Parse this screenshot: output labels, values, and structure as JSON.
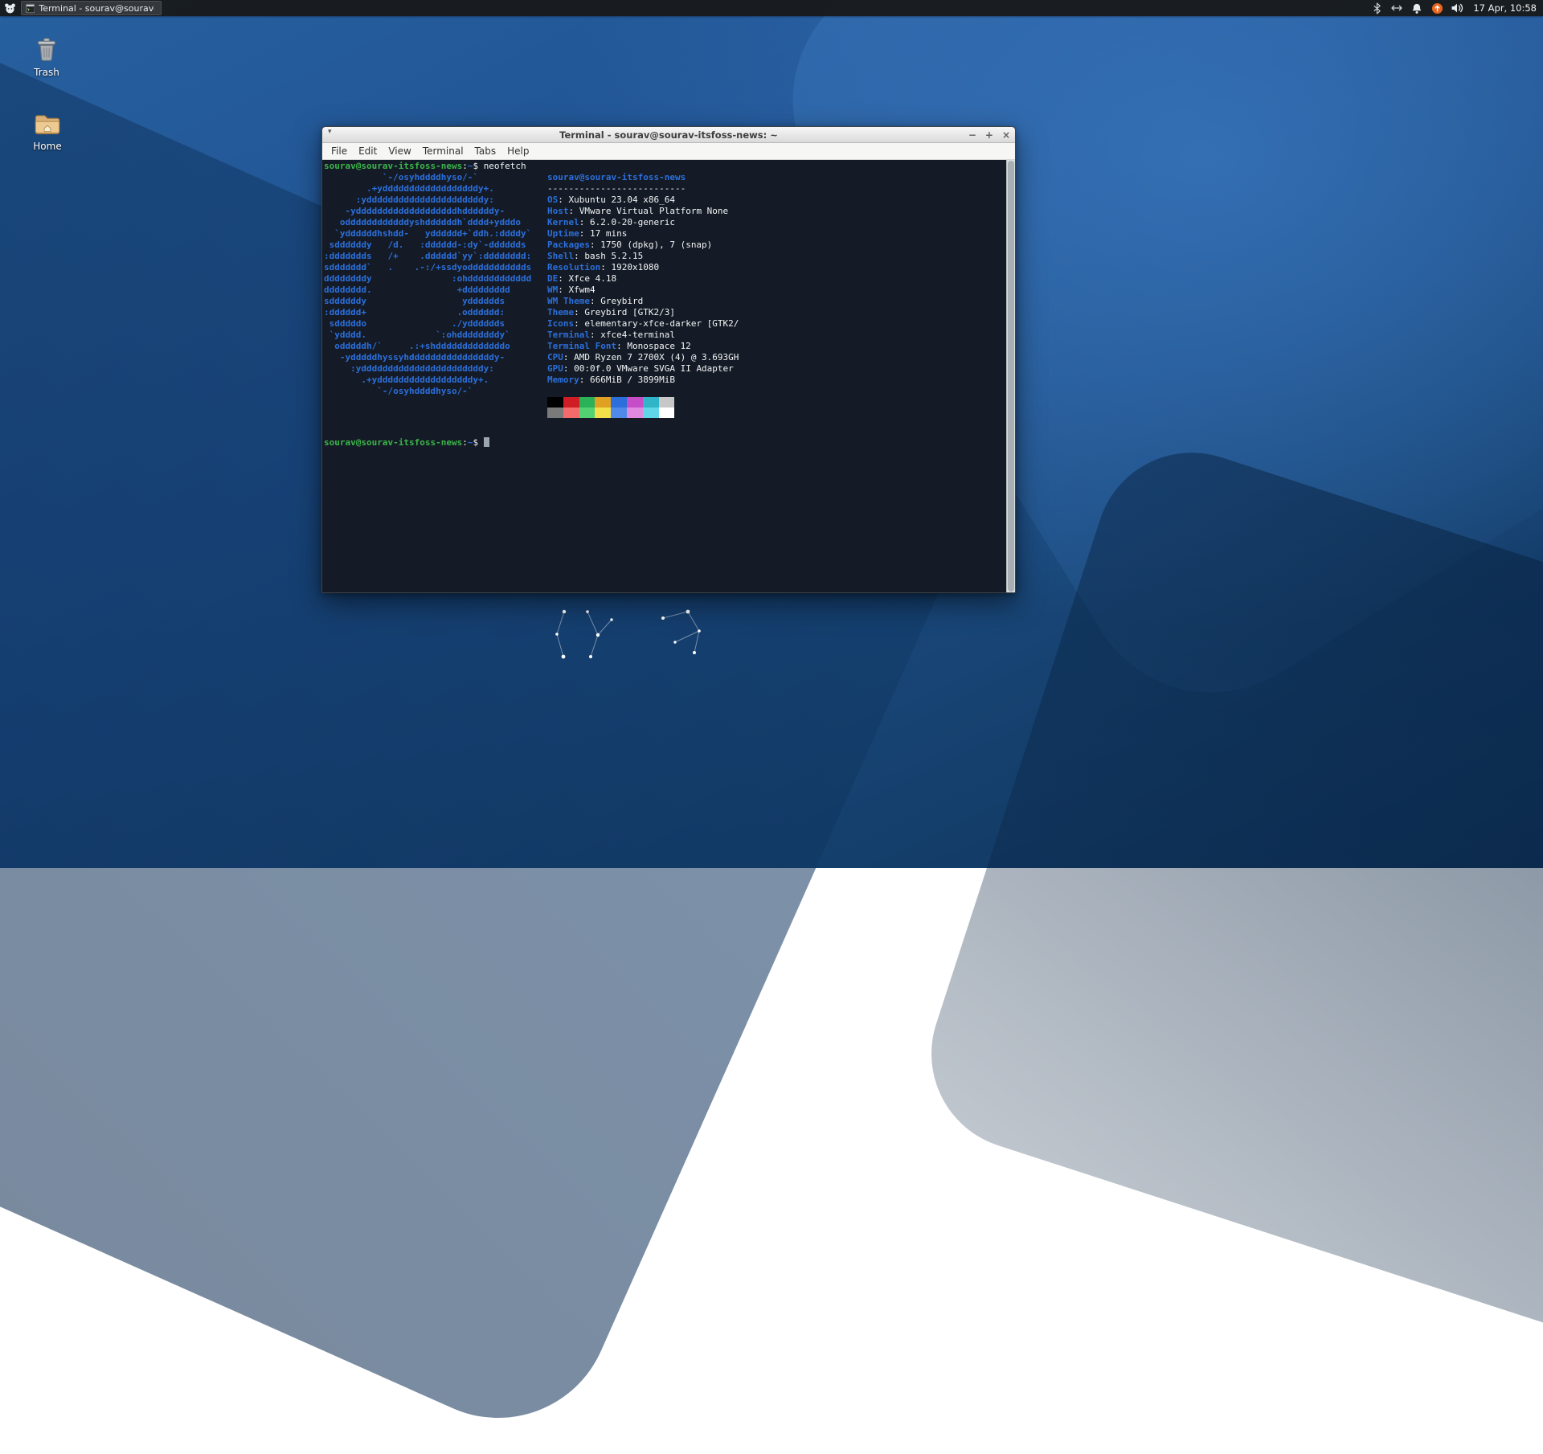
{
  "panel": {
    "window_button": "Terminal - sourav@sourav-it...",
    "clock": "17 Apr, 10:58"
  },
  "desktop": {
    "trash_label": "Trash",
    "home_label": "Home"
  },
  "window": {
    "title": "Terminal - sourav@sourav-itsfoss-news: ~",
    "menu": [
      "File",
      "Edit",
      "View",
      "Terminal",
      "Tabs",
      "Help"
    ],
    "controls": {
      "menu": "▾",
      "minimize": "−",
      "maximize": "+",
      "close": "×"
    }
  },
  "terminal": {
    "prompt_user": "sourav@sourav-itsfoss-news",
    "prompt_colon": ":",
    "prompt_path": "~",
    "prompt_dollar": "$",
    "command": "neofetch",
    "ascii_art": [
      "           `-/osyhddddhyso/-`",
      "        .+yddddddddddddddddddy+.",
      "      :yddddddddddddddddddddddy:",
      "    -ydddddddddddddddddddhddddddy-",
      "   oddddddddddddyshddddddh`dddd+ydddo",
      "  `yddddddhshdd-   ydddddd+`ddh.:ddddy`",
      " sddddddy   /d.   :dddddd-:dy`-dddddds",
      ":ddddddds   /+    .dddddd`yy`:dddddddd:",
      "sddddddd`   .    .-:/+ssdyoddddddddddds",
      "ddddddddy               :ohdddddddddddd",
      "dddddddd.                +ddddddddd",
      "sddddddy                  ydddddds",
      ":dddddd+                 .odddddd:",
      " sdddddo                ./ydddddds",
      " `ydddd.             `:ohddddddddy`",
      "  odddddh/`     .:+shdddddddddddddo",
      "   -ydddddhyssyhddddddddddddddddy-",
      "     :ydddddddddddddddddddddddy:",
      "       .+yddddddddddddddddddy+.",
      "          `-/osyhddddhyso/-`"
    ],
    "title_line": "sourav@sourav-itsfoss-news",
    "separator": "--------------------------",
    "info": [
      {
        "label": "OS",
        "value": "Xubuntu 23.04 x86_64"
      },
      {
        "label": "Host",
        "value": "VMware Virtual Platform None"
      },
      {
        "label": "Kernel",
        "value": "6.2.0-20-generic"
      },
      {
        "label": "Uptime",
        "value": "17 mins"
      },
      {
        "label": "Packages",
        "value": "1750 (dpkg), 7 (snap)"
      },
      {
        "label": "Shell",
        "value": "bash 5.2.15"
      },
      {
        "label": "Resolution",
        "value": "1920x1080"
      },
      {
        "label": "DE",
        "value": "Xfce 4.18"
      },
      {
        "label": "WM",
        "value": "Xfwm4"
      },
      {
        "label": "WM Theme",
        "value": "Greybird"
      },
      {
        "label": "Theme",
        "value": "Greybird [GTK2/3]"
      },
      {
        "label": "Icons",
        "value": "elementary-xfce-darker [GTK2/"
      },
      {
        "label": "Terminal",
        "value": "xfce4-terminal"
      },
      {
        "label": "Terminal Font",
        "value": "Monospace 12"
      },
      {
        "label": "CPU",
        "value": "AMD Ryzen 7 2700X (4) @ 3.693GH"
      },
      {
        "label": "GPU",
        "value": "00:0f.0 VMware SVGA II Adapter"
      },
      {
        "label": "Memory",
        "value": "666MiB / 3899MiB"
      }
    ],
    "palette_row1": [
      "#000000",
      "#d01c24",
      "#2bb158",
      "#e0a022",
      "#2c6fdb",
      "#c54dc8",
      "#30b5c8",
      "#c7c7c7"
    ],
    "palette_row2": [
      "#7a7a7a",
      "#f56b6b",
      "#52d273",
      "#f3df49",
      "#4f8ae8",
      "#df8ae0",
      "#5fd7e8",
      "#ffffff"
    ],
    "accent_colors": {
      "prompt_green": "#3cb54a",
      "neofetch_blue": "#2c6fdb",
      "foreground": "#f3f4f5",
      "background": "#141b26"
    }
  }
}
